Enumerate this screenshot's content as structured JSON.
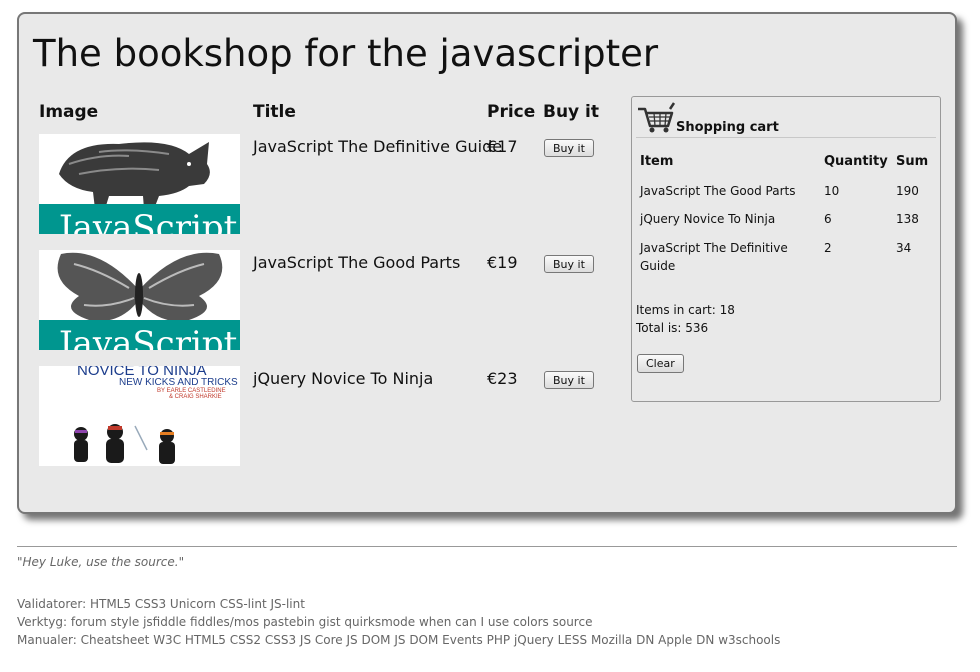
{
  "page": {
    "title": "The bookshop for the javascripter"
  },
  "catalog": {
    "headers": {
      "image": "Image",
      "title": "Title",
      "price": "Price",
      "buy": "Buy it"
    },
    "books": [
      {
        "title": "JavaScript The Definitive Guide",
        "price": "€17",
        "buy_label": "Buy it",
        "cover_text": "JavaScript"
      },
      {
        "title": "JavaScript The Good Parts",
        "price": "€19",
        "buy_label": "Buy it",
        "cover_text": "JavaScript:"
      },
      {
        "title": "jQuery Novice To Ninja",
        "price": "€23",
        "buy_label": "Buy it",
        "cover_title": "NOVICE TO NINJA",
        "cover_subtitle": "NEW KICKS AND TRICKS",
        "cover_by": "BY EARLE CASTLEDINE",
        "cover_by2": "& CRAIG SHARKIE"
      }
    ]
  },
  "cart": {
    "title": "Shopping cart",
    "headers": {
      "item": "Item",
      "quantity": "Quantity",
      "sum": "Sum"
    },
    "items": [
      {
        "name": "JavaScript The Good Parts",
        "quantity": "10",
        "sum": "190"
      },
      {
        "name": "jQuery Novice To Ninja",
        "quantity": "6",
        "sum": "138"
      },
      {
        "name_line1": "JavaScript The Definitive",
        "name_line2": "Guide",
        "quantity": "2",
        "sum": "34"
      }
    ],
    "items_in_cart": "Items in cart: 18",
    "total": "Total is: 536",
    "clear_label": "Clear"
  },
  "footer": {
    "quote": "\"Hey Luke, use the source.\"",
    "validators_label": "Validatorer:",
    "validators": [
      "HTML5",
      "CSS3",
      "Unicorn",
      "CSS-lint",
      "JS-lint"
    ],
    "tools_label": "Verktyg:",
    "tools": [
      "forum",
      "style",
      "jsfiddle",
      "fiddles/mos",
      "pastebin",
      "gist",
      "quirksmode",
      "when can I use",
      "colors",
      "source"
    ],
    "manuals_label": "Manualer:",
    "manuals": [
      "Cheatsheet",
      "W3C",
      "HTML5",
      "CSS2",
      "CSS3",
      "JS Core",
      "JS DOM",
      "JS DOM Events",
      "PHP",
      "jQuery",
      "LESS",
      "Mozilla DN",
      "Apple DN",
      "w3schools"
    ]
  },
  "colors": {
    "panel_bg": "#e9e9e9",
    "teal": "#00968f",
    "footer_text": "#666666"
  }
}
